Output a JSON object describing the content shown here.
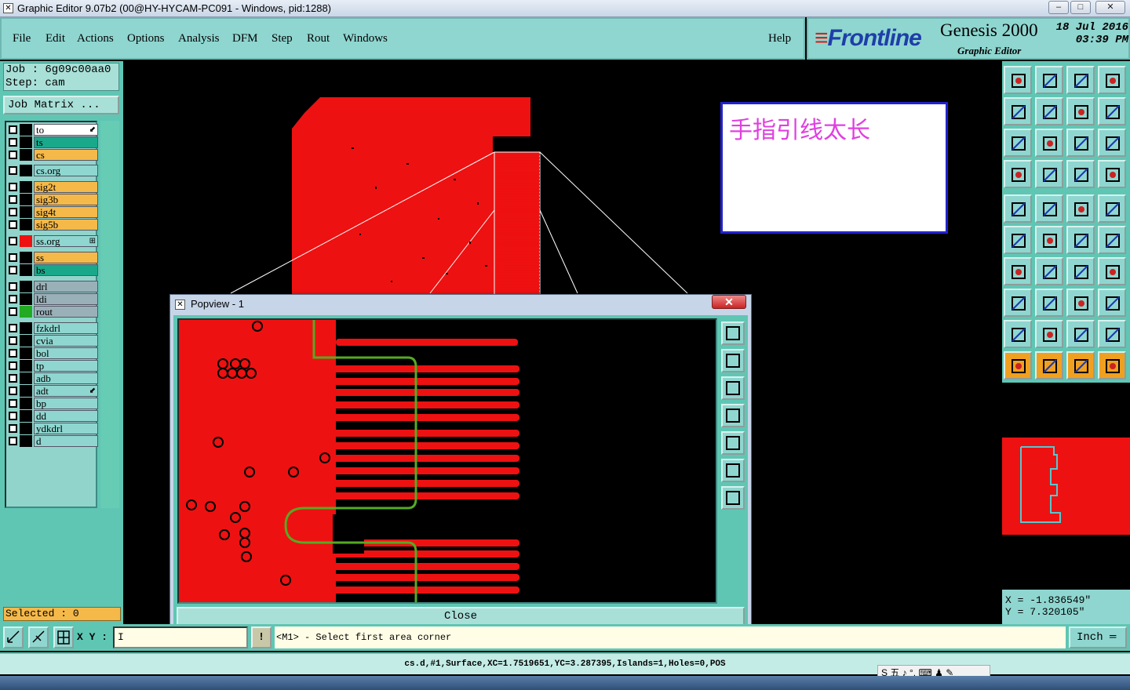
{
  "window": {
    "title": "Graphic Editor 9.07b2 (00@HY-HYCAM-PC091 - Windows, pid:1288)",
    "minimize": "–",
    "maximize": "□",
    "close": "✕"
  },
  "menu": {
    "items": [
      "File",
      "Edit",
      "Actions",
      "Options",
      "Analysis",
      "DFM",
      "Step",
      "Rout",
      "Windows"
    ],
    "help": "Help"
  },
  "brand": {
    "logo": "Frontline",
    "product": "Genesis 2000",
    "subtitle": "Graphic Editor",
    "date": "18 Jul 2016",
    "time": "03:39 PM"
  },
  "job": {
    "job_line": "Job : 6g09c00aa0",
    "step_line": "Step: cam",
    "matrix_button": "Job Matrix ..."
  },
  "layers": [
    {
      "name": "to",
      "color": "#ffffff",
      "swatch": "#000000",
      "marker": "⬋"
    },
    {
      "name": "ts",
      "color": "#1aa88a",
      "swatch": "#000000",
      "marker": ""
    },
    {
      "name": "cs",
      "color": "#f5b94a",
      "swatch": "#000000",
      "marker": ""
    },
    {
      "name": "cs.org",
      "color": "#8fd6d0",
      "swatch": "#000000",
      "marker": ""
    },
    {
      "name": "sig2t",
      "color": "#f5b94a",
      "swatch": "#000000",
      "marker": ""
    },
    {
      "name": "sig3b",
      "color": "#f5b94a",
      "swatch": "#000000",
      "marker": ""
    },
    {
      "name": "sig4t",
      "color": "#f5b94a",
      "swatch": "#000000",
      "marker": ""
    },
    {
      "name": "sig5b",
      "color": "#f5b94a",
      "swatch": "#000000",
      "marker": ""
    },
    {
      "name": "ss.org",
      "color": "#8fd6d0",
      "swatch": "#ee1111",
      "marker": "⊞"
    },
    {
      "name": "ss",
      "color": "#f5b94a",
      "swatch": "#000000",
      "marker": ""
    },
    {
      "name": "bs",
      "color": "#1aa88a",
      "swatch": "#000000",
      "marker": ""
    },
    {
      "name": "drl",
      "color": "#9ab0b8",
      "swatch": "#000000",
      "marker": ""
    },
    {
      "name": "ldi",
      "color": "#9ab0b8",
      "swatch": "#000000",
      "marker": ""
    },
    {
      "name": "rout",
      "color": "#9ab0b8",
      "swatch": "#22aa22",
      "marker": ""
    },
    {
      "name": "fzkdrl",
      "color": "#8fd6d0",
      "swatch": "#000000",
      "marker": ""
    },
    {
      "name": "cvia",
      "color": "#8fd6d0",
      "swatch": "#000000",
      "marker": ""
    },
    {
      "name": "bol",
      "color": "#8fd6d0",
      "swatch": "#000000",
      "marker": ""
    },
    {
      "name": "tp",
      "color": "#8fd6d0",
      "swatch": "#000000",
      "marker": ""
    },
    {
      "name": "adb",
      "color": "#8fd6d0",
      "swatch": "#000000",
      "marker": ""
    },
    {
      "name": "adt",
      "color": "#8fd6d0",
      "swatch": "#000000",
      "marker": "⬋"
    },
    {
      "name": "bp",
      "color": "#8fd6d0",
      "swatch": "#000000",
      "marker": ""
    },
    {
      "name": "dd",
      "color": "#8fd6d0",
      "swatch": "#000000",
      "marker": ""
    },
    {
      "name": "ydkdrl",
      "color": "#8fd6d0",
      "swatch": "#000000",
      "marker": ""
    },
    {
      "name": "d",
      "color": "#8fd6d0",
      "swatch": "#000000",
      "marker": ""
    }
  ],
  "selected": "Selected : 0",
  "note": "手指引线太长",
  "popup": {
    "title": "Popview - 1",
    "close_label": "Close",
    "close_x": "✕"
  },
  "coords": {
    "x": "X = -1.836549\"",
    "y": "Y = 7.320105\""
  },
  "bottom": {
    "xy_label": "X Y :",
    "xy_value": "I",
    "message": "<M1> - Select first area corner",
    "unit": "Inch ═"
  },
  "status": "cs.d,#1,Surface,XC=1.7519651,YC=3.287395,Islands=1,Holes=0,POS",
  "ime": "S 五 ♪ °, ⌨ ♟ ✎",
  "colors": {
    "copper": "#ee1111",
    "panel": "#5fc6b4",
    "button": "#8fd6d0",
    "rout_outline": "#55aa22"
  }
}
